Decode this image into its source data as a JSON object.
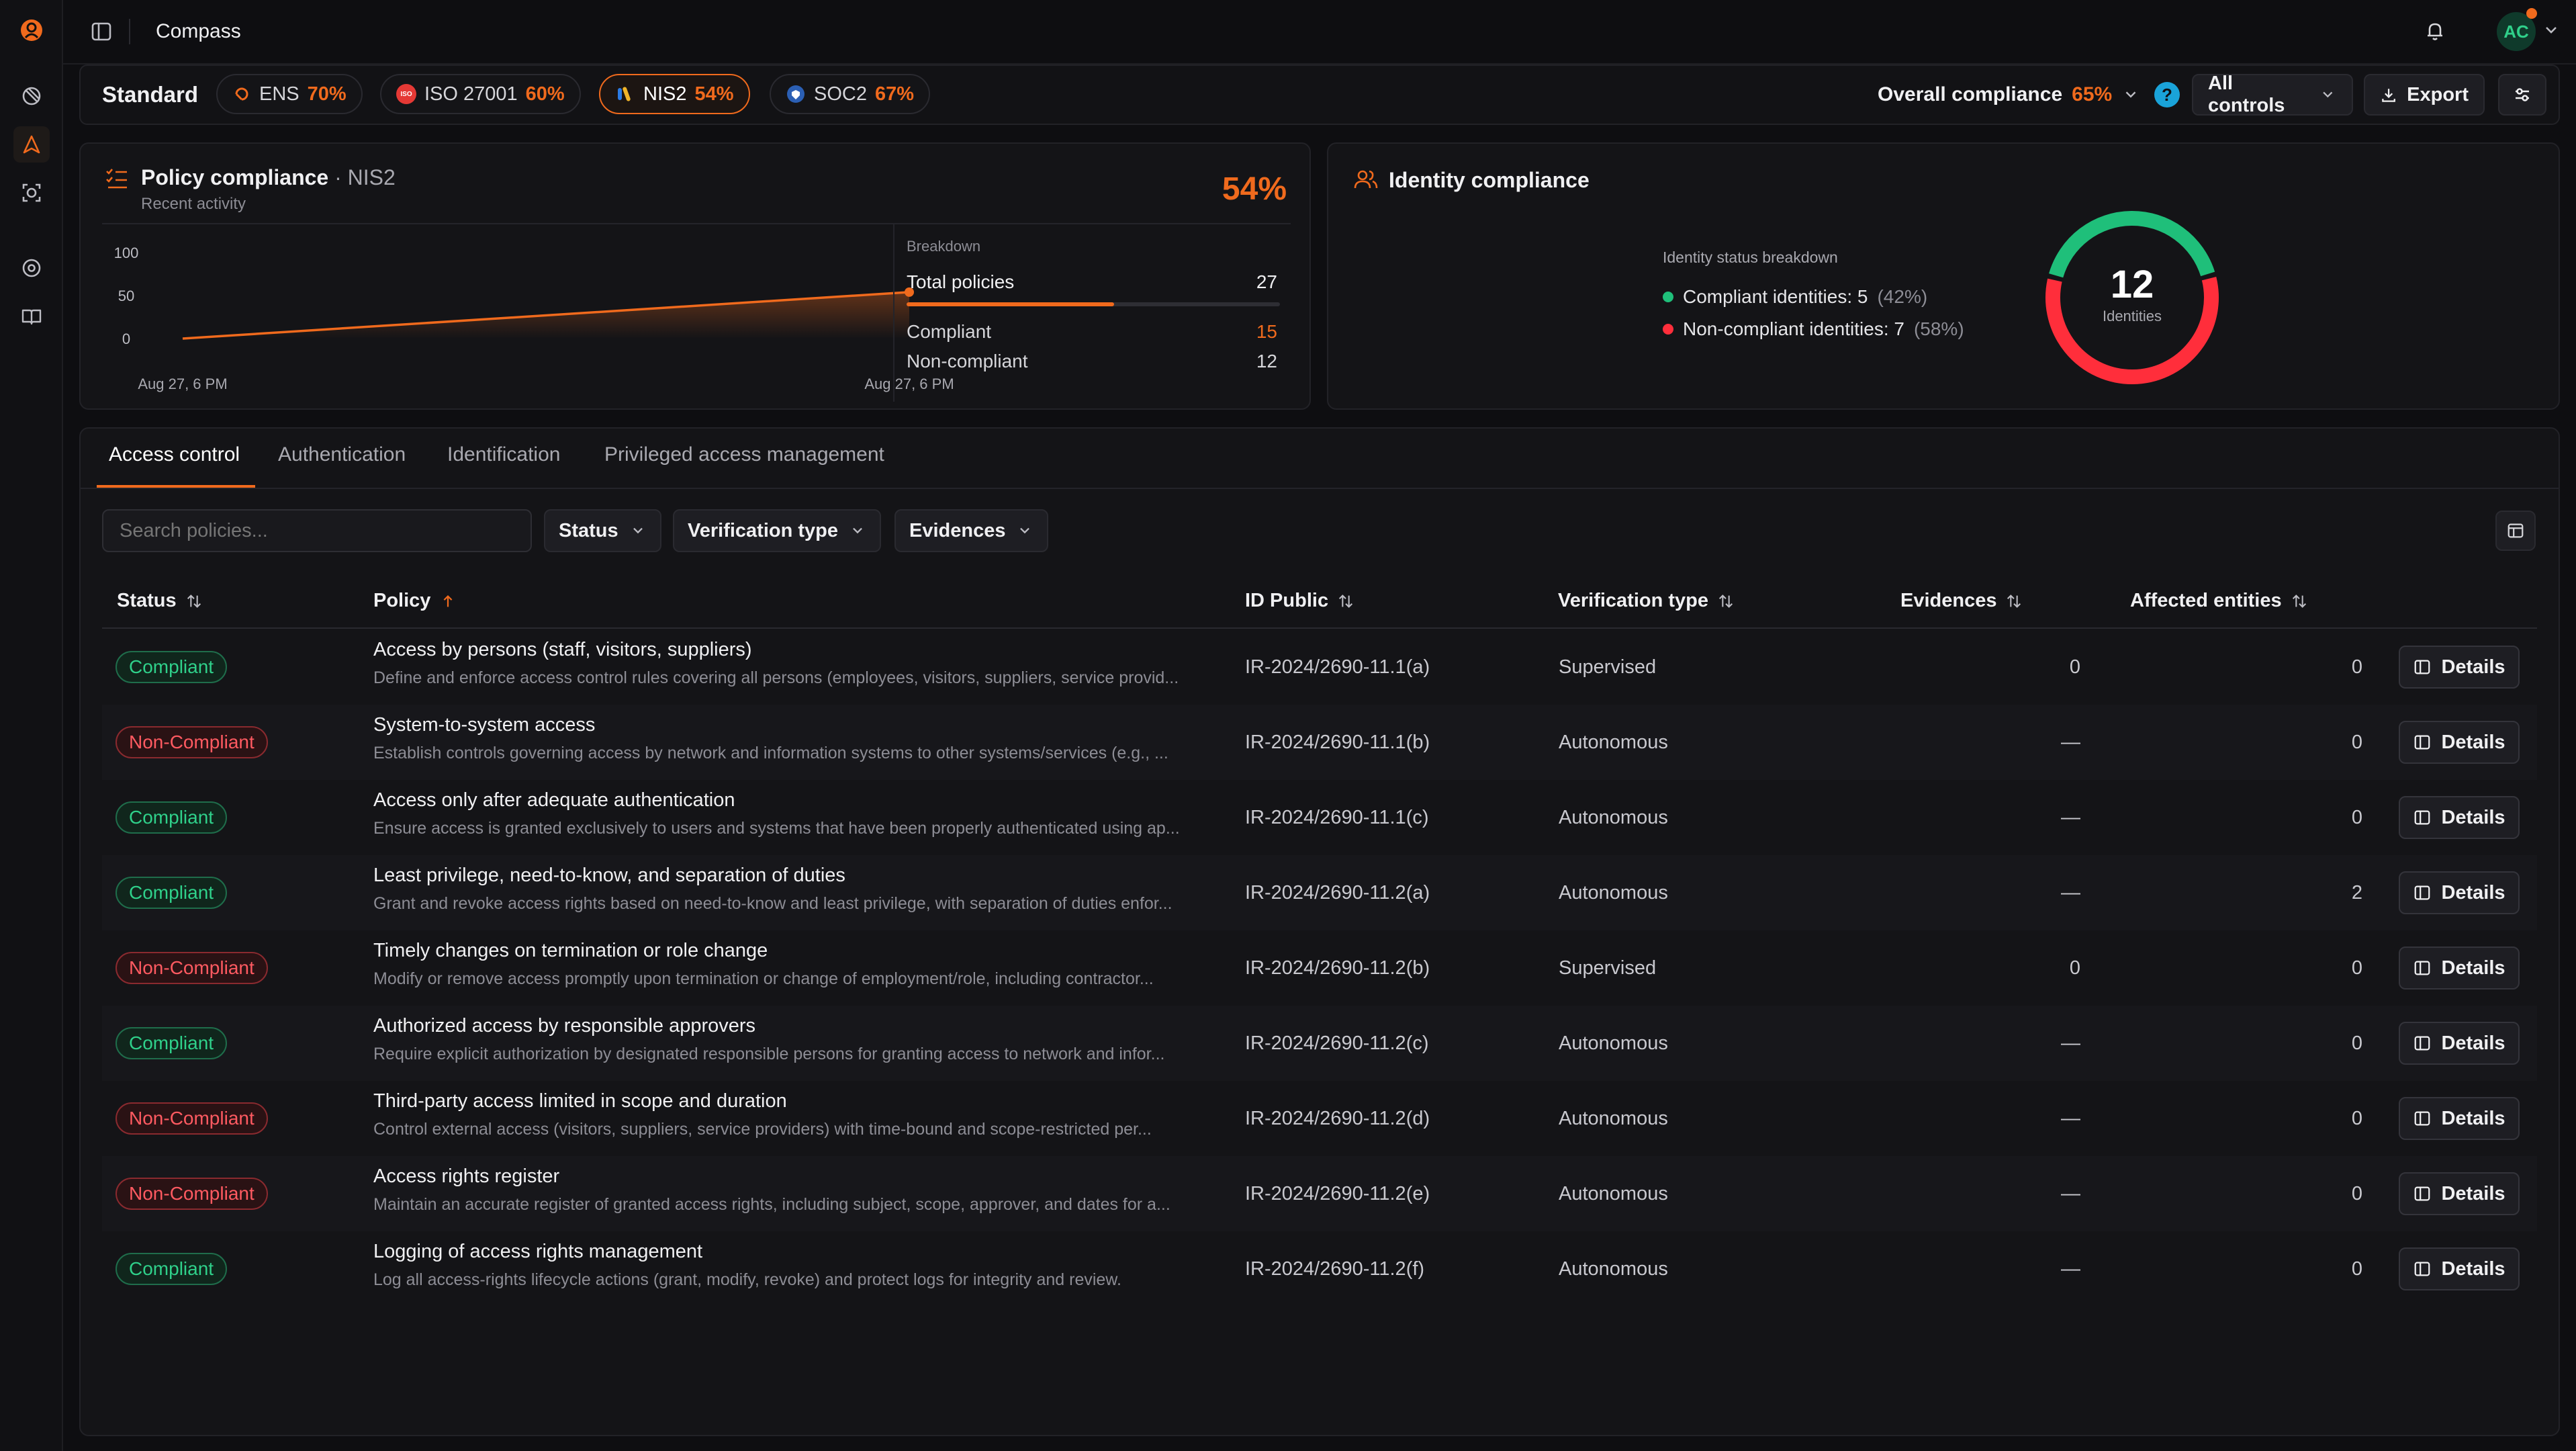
{
  "app": {
    "title": "Compass"
  },
  "user": {
    "initials": "AC"
  },
  "standards": {
    "label": "Standard",
    "items": [
      {
        "name": "ENS",
        "pct": "70%"
      },
      {
        "name": "ISO 27001",
        "pct": "60%"
      },
      {
        "name": "NIS2",
        "pct": "54%",
        "active": true
      },
      {
        "name": "SOC2",
        "pct": "67%"
      }
    ],
    "overall_label": "Overall compliance",
    "overall_pct": "65%",
    "controls_label": "All controls",
    "export_label": "Export"
  },
  "policy_card": {
    "title": "Policy compliance",
    "standard": "NIS2",
    "subtitle": "Recent activity",
    "big_pct": "54%",
    "chart_data": {
      "type": "area",
      "x": [
        "Aug 27, 6 PM",
        "Aug 27, 6 PM"
      ],
      "values": [
        0,
        54
      ],
      "y_ticks": [
        "100",
        "50",
        "0"
      ],
      "ylim": [
        0,
        100
      ],
      "x_labels": [
        "Aug 27, 6 PM",
        "Aug 27, 6 PM"
      ]
    },
    "breakdown": {
      "title": "Breakdown",
      "total_label": "Total policies",
      "total_value": "27",
      "compliant_label": "Compliant",
      "compliant_value": "15",
      "noncompliant_label": "Non-compliant",
      "noncompliant_value": "12",
      "compliant_fraction": 0.556
    }
  },
  "identity_card": {
    "title": "Identity compliance",
    "breakdown_title": "Identity status breakdown",
    "compliant_text": "Compliant identities: 5",
    "compliant_pct": "(42%)",
    "noncompliant_text": "Non-compliant identities: 7",
    "noncompliant_pct": "(58%)",
    "total": "12",
    "total_label": "Identities",
    "colors": {
      "compliant": "#1fbf7a",
      "noncompliant": "#ff2e3b"
    },
    "chart_data": {
      "type": "pie",
      "categories": [
        "Compliant identities",
        "Non-compliant identities"
      ],
      "values": [
        5,
        7
      ]
    }
  },
  "tabs": [
    "Access control",
    "Authentication",
    "Identification",
    "Privileged access management"
  ],
  "filters": {
    "search_placeholder": "Search policies...",
    "status": "Status",
    "verification": "Verification type",
    "evidences": "Evidences"
  },
  "table": {
    "headers": {
      "status": "Status",
      "policy": "Policy",
      "id": "ID Public",
      "verification": "Verification type",
      "evidences": "Evidences",
      "affected": "Affected entities"
    },
    "details_label": "Details",
    "rows": [
      {
        "status": "Compliant",
        "ok": true,
        "title": "Access by persons (staff, visitors, suppliers)",
        "desc": "Define and enforce access control rules covering all persons (employees, visitors, suppliers, service provid...",
        "id": "IR-2024/2690-11.1(a)",
        "verification": "Supervised",
        "evidences": "0",
        "affected": "0"
      },
      {
        "status": "Non-Compliant",
        "ok": false,
        "title": "System-to-system access",
        "desc": "Establish controls governing access by network and information systems to other systems/services (e.g., ...",
        "id": "IR-2024/2690-11.1(b)",
        "verification": "Autonomous",
        "evidences": "—",
        "affected": "0"
      },
      {
        "status": "Compliant",
        "ok": true,
        "title": "Access only after adequate authentication",
        "desc": "Ensure access is granted exclusively to users and systems that have been properly authenticated using ap...",
        "id": "IR-2024/2690-11.1(c)",
        "verification": "Autonomous",
        "evidences": "—",
        "affected": "0"
      },
      {
        "status": "Compliant",
        "ok": true,
        "title": "Least privilege, need-to-know, and separation of duties",
        "desc": "Grant and revoke access rights based on need-to-know and least privilege, with separation of duties enfor...",
        "id": "IR-2024/2690-11.2(a)",
        "verification": "Autonomous",
        "evidences": "—",
        "affected": "2"
      },
      {
        "status": "Non-Compliant",
        "ok": false,
        "title": "Timely changes on termination or role change",
        "desc": "Modify or remove access promptly upon termination or change of employment/role, including contractor...",
        "id": "IR-2024/2690-11.2(b)",
        "verification": "Supervised",
        "evidences": "0",
        "affected": "0"
      },
      {
        "status": "Compliant",
        "ok": true,
        "title": "Authorized access by responsible approvers",
        "desc": "Require explicit authorization by designated responsible persons for granting access to network and infor...",
        "id": "IR-2024/2690-11.2(c)",
        "verification": "Autonomous",
        "evidences": "—",
        "affected": "0"
      },
      {
        "status": "Non-Compliant",
        "ok": false,
        "title": "Third-party access limited in scope and duration",
        "desc": "Control external access (visitors, suppliers, service providers) with time-bound and scope-restricted per...",
        "id": "IR-2024/2690-11.2(d)",
        "verification": "Autonomous",
        "evidences": "—",
        "affected": "0"
      },
      {
        "status": "Non-Compliant",
        "ok": false,
        "title": "Access rights register",
        "desc": "Maintain an accurate register of granted access rights, including subject, scope, approver, and dates for a...",
        "id": "IR-2024/2690-11.2(e)",
        "verification": "Autonomous",
        "evidences": "—",
        "affected": "0"
      },
      {
        "status": "Compliant",
        "ok": true,
        "title": "Logging of access rights management",
        "desc": "Log all access-rights lifecycle actions (grant, modify, revoke) and protect logs for integrity and review.",
        "id": "IR-2024/2690-11.2(f)",
        "verification": "Autonomous",
        "evidences": "—",
        "affected": "0"
      }
    ]
  }
}
